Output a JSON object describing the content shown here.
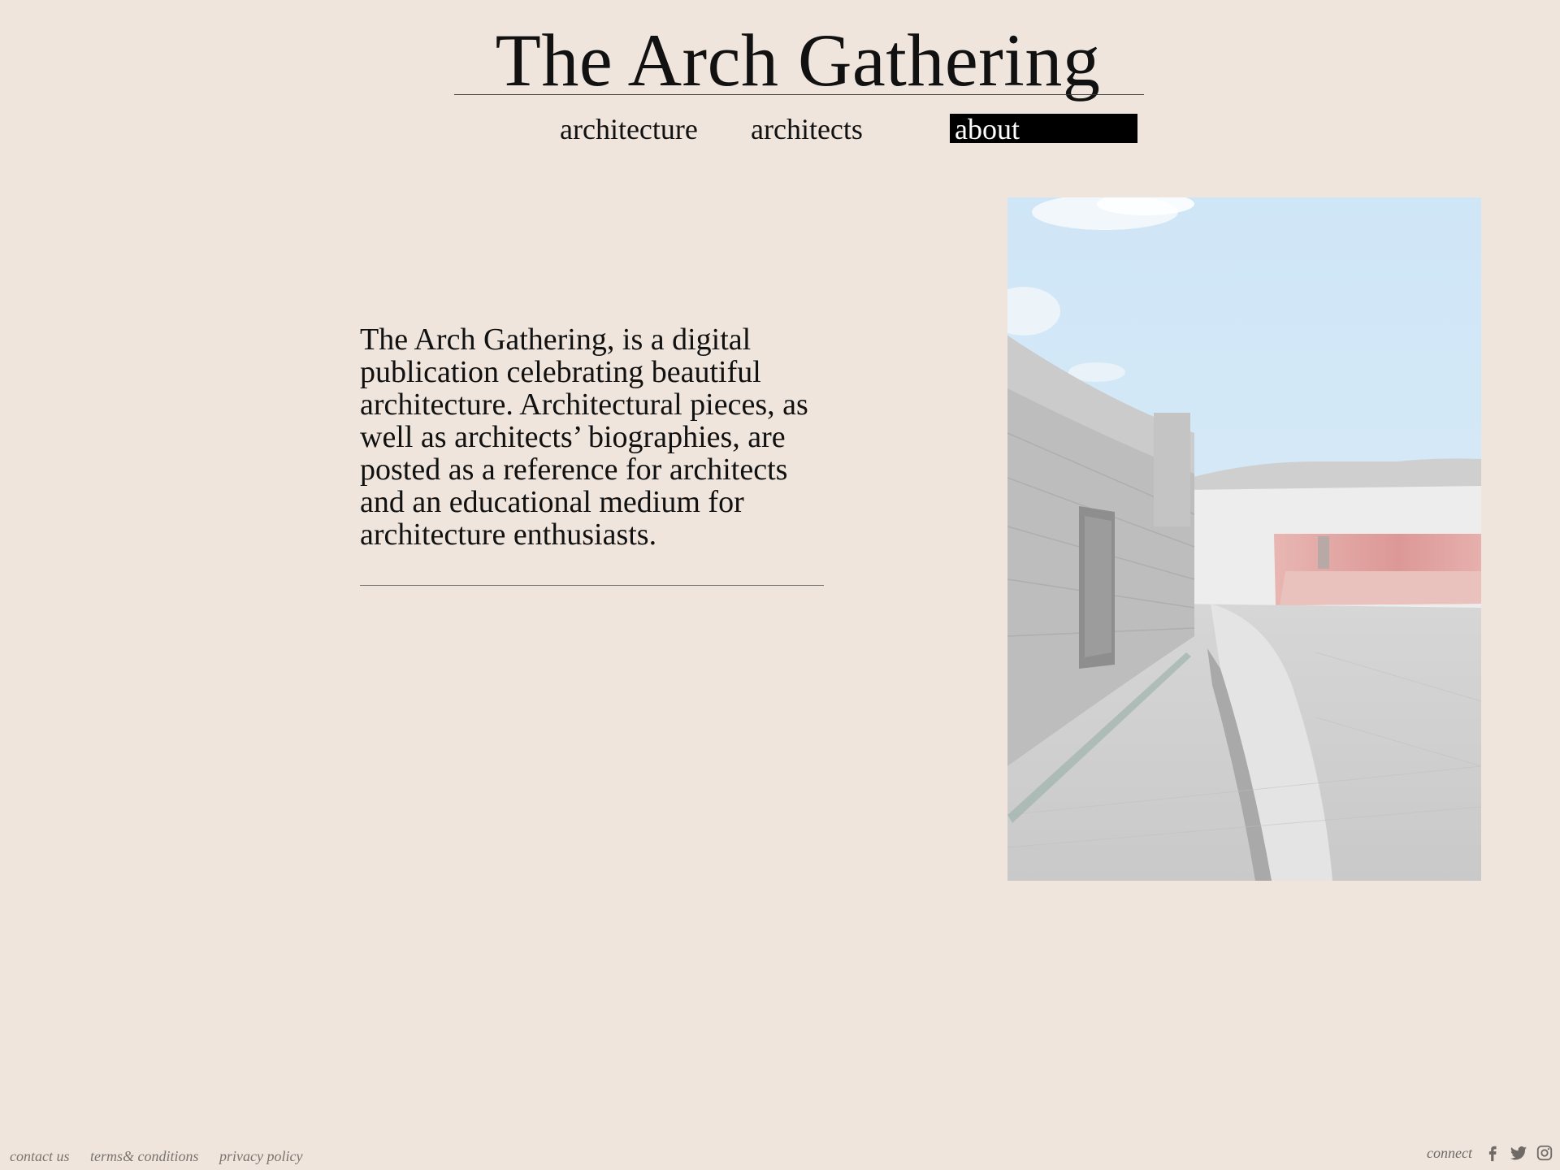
{
  "header": {
    "title": "The Arch Gathering"
  },
  "nav": {
    "items": [
      {
        "label": "architecture"
      },
      {
        "label": "architects"
      },
      {
        "label": "about",
        "active": true
      }
    ]
  },
  "main": {
    "about_text": "The Arch Gathering, is a digital publication celebrating beautiful architecture. Architectural pieces, as well as architects’ biographies, are posted as a reference for architects and an educational medium for architecture enthusiasts.",
    "image_icon": "architecture-photo"
  },
  "footer": {
    "links": [
      {
        "label": "contact us"
      },
      {
        "label": "terms& conditions"
      },
      {
        "label": "privacy policy"
      }
    ],
    "connect_label": "connect",
    "social_icons": [
      "facebook-icon",
      "twitter-icon",
      "instagram-icon"
    ]
  },
  "colors": {
    "background": "#efe5dd",
    "text": "#111111",
    "active_nav_bg": "#000000",
    "active_nav_text": "#ffffff",
    "footer_text": "#7a7470"
  }
}
